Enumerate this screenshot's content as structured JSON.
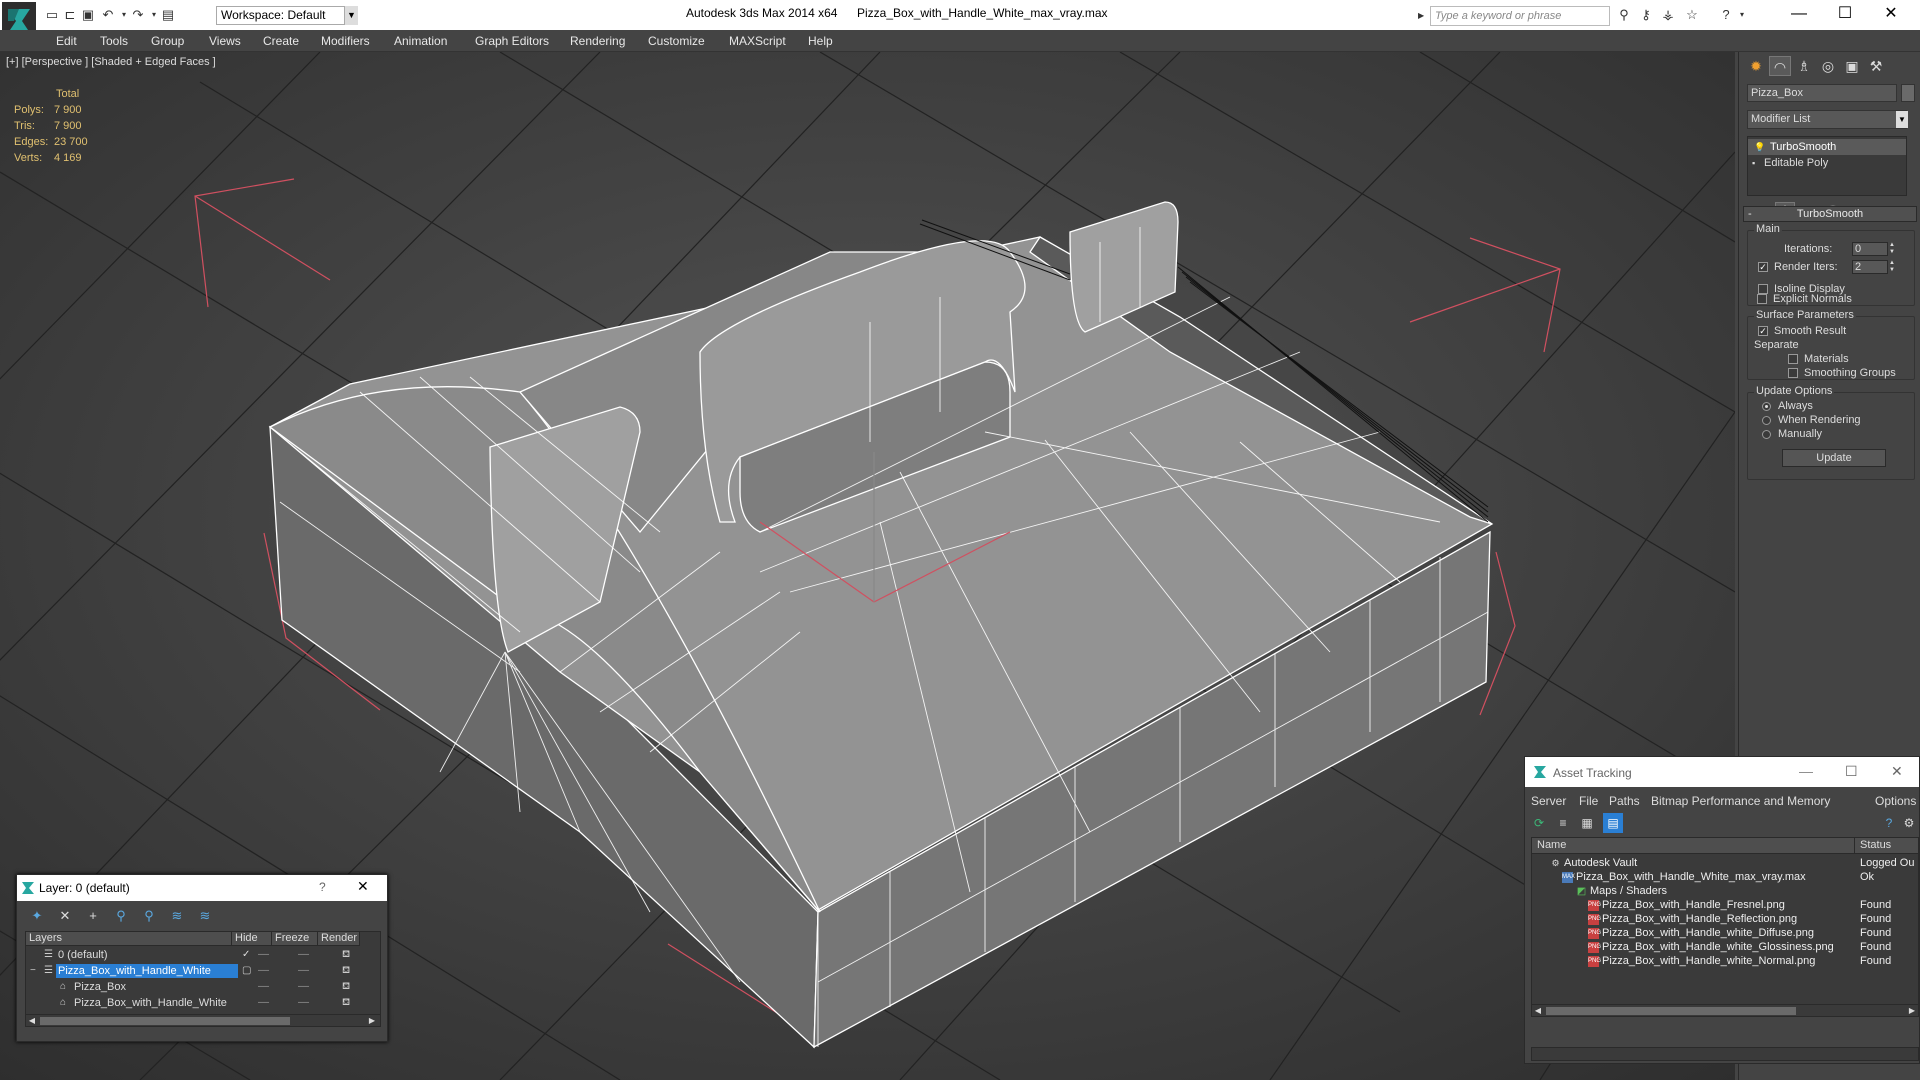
{
  "titlebar": {
    "workspace": "Workspace: Default",
    "app_title": "Autodesk 3ds Max  2014 x64",
    "file_title": "Pizza_Box_with_Handle_White_max_vray.max",
    "search_placeholder": "Type a keyword or phrase"
  },
  "menu": [
    "Edit",
    "Tools",
    "Group",
    "Views",
    "Create",
    "Modifiers",
    "Animation",
    "Graph Editors",
    "Rendering",
    "Customize",
    "MAXScript",
    "Help"
  ],
  "viewport": {
    "label": "[+] [Perspective ] [Shaded + Edged Faces ]",
    "stats_header": "Total",
    "stats": [
      {
        "label": "Polys:",
        "value": "7 900"
      },
      {
        "label": "Tris:",
        "value": "7 900"
      },
      {
        "label": "Edges:",
        "value": "23 700"
      },
      {
        "label": "Verts:",
        "value": "4 169"
      }
    ]
  },
  "command_panel": {
    "object_name": "Pizza_Box",
    "modifier_list": "Modifier List",
    "stack": [
      "TurboSmooth",
      "Editable Poly"
    ],
    "rollout_title": "TurboSmooth",
    "main_label": "Main",
    "iterations_label": "Iterations:",
    "iterations_value": "0",
    "render_iters_label": "Render Iters:",
    "render_iters_value": "2",
    "isoline_label": "Isoline Display",
    "explicit_normals_label": "Explicit Normals",
    "surface_params_label": "Surface Parameters",
    "smooth_result_label": "Smooth Result",
    "separate_label": "Separate",
    "materials_label": "Materials",
    "smoothing_groups_label": "Smoothing Groups",
    "update_options_label": "Update Options",
    "always_label": "Always",
    "when_rendering_label": "When Rendering",
    "manually_label": "Manually",
    "update_button": "Update"
  },
  "layer_window": {
    "title": "Layer: 0 (default)",
    "columns": [
      "Layers",
      "Hide",
      "Freeze",
      "Render"
    ],
    "rows": [
      {
        "name": "0 (default)",
        "indent": 0
      },
      {
        "name": "Pizza_Box_with_Handle_White",
        "indent": 0
      },
      {
        "name": "Pizza_Box",
        "indent": 1
      },
      {
        "name": "Pizza_Box_with_Handle_White",
        "indent": 1
      }
    ]
  },
  "asset_window": {
    "title": "Asset Tracking",
    "menu": [
      "Server",
      "File",
      "Paths",
      "Bitmap Performance and Memory",
      "Options"
    ],
    "columns": [
      "Name",
      "Status"
    ],
    "rows": [
      {
        "name": "Autodesk Vault",
        "status": "Logged Ou",
        "level": 0,
        "icon": "vault-icon"
      },
      {
        "name": "Pizza_Box_with_Handle_White_max_vray.max",
        "status": "Ok",
        "level": 1,
        "icon": "max-file-icon"
      },
      {
        "name": "Maps / Shaders",
        "status": "",
        "level": 2,
        "icon": "maps-icon"
      },
      {
        "name": "Pizza_Box_with_Handle_Fresnel.png",
        "status": "Found",
        "level": 3,
        "icon": "png-icon"
      },
      {
        "name": "Pizza_Box_with_Handle_Reflection.png",
        "status": "Found",
        "level": 3,
        "icon": "png-icon"
      },
      {
        "name": "Pizza_Box_with_Handle_white_Diffuse.png",
        "status": "Found",
        "level": 3,
        "icon": "png-icon"
      },
      {
        "name": "Pizza_Box_with_Handle_white_Glossiness.png",
        "status": "Found",
        "level": 3,
        "icon": "png-icon"
      },
      {
        "name": "Pizza_Box_with_Handle_white_Normal.png",
        "status": "Found",
        "level": 3,
        "icon": "png-icon"
      }
    ]
  },
  "colors": {
    "ui_background": "#444444",
    "viewport_background": "#3c3c3c",
    "stats_text": "#e0c070",
    "selection": "#2a7fd4",
    "bounding_box": "#d05060",
    "mesh_fill": "#8f8f8f",
    "wire": "#ffffff"
  }
}
